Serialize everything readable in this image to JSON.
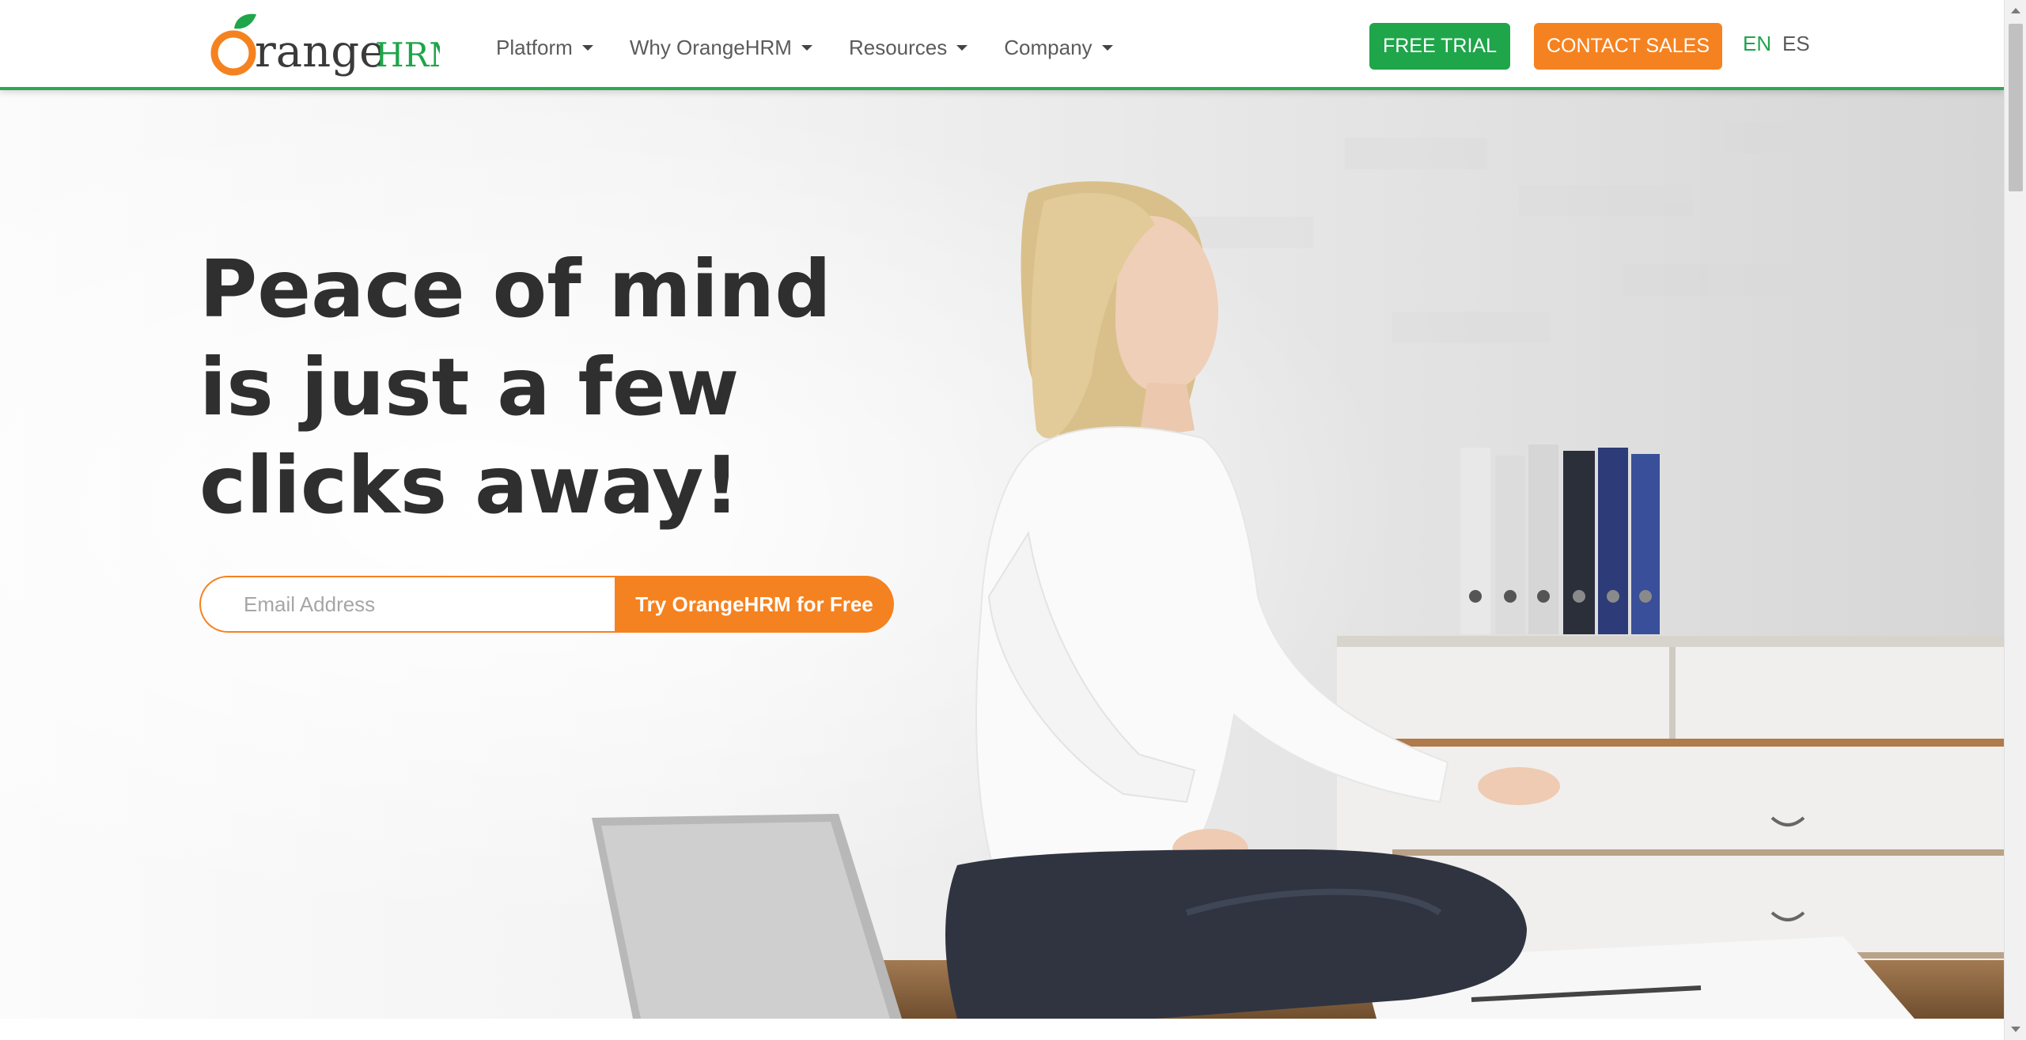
{
  "brand": {
    "logo_prefix": "O",
    "logo_main": "range",
    "logo_suffix": "HRM",
    "colors": {
      "green": "#1fa54a",
      "orange": "#f58220",
      "text_dark": "#2f2f2f",
      "nav_text": "#5b5b5b"
    }
  },
  "nav": {
    "items": [
      {
        "label": "Platform",
        "icon": "caret-down-icon"
      },
      {
        "label": "Why OrangeHRM",
        "icon": "caret-down-icon"
      },
      {
        "label": "Resources",
        "icon": "caret-down-icon"
      },
      {
        "label": "Company",
        "icon": "caret-down-icon"
      }
    ]
  },
  "header_actions": {
    "free_trial": "FREE TRIAL",
    "contact_sales": "CONTACT SALES",
    "languages": [
      "EN",
      "ES"
    ],
    "active_language": "EN"
  },
  "hero": {
    "headline_lines": [
      "Peace of mind",
      "is just a few",
      "clicks away!"
    ],
    "email_placeholder": "Email Address",
    "email_value": "",
    "cta_label": "Try OrangeHRM for Free"
  }
}
